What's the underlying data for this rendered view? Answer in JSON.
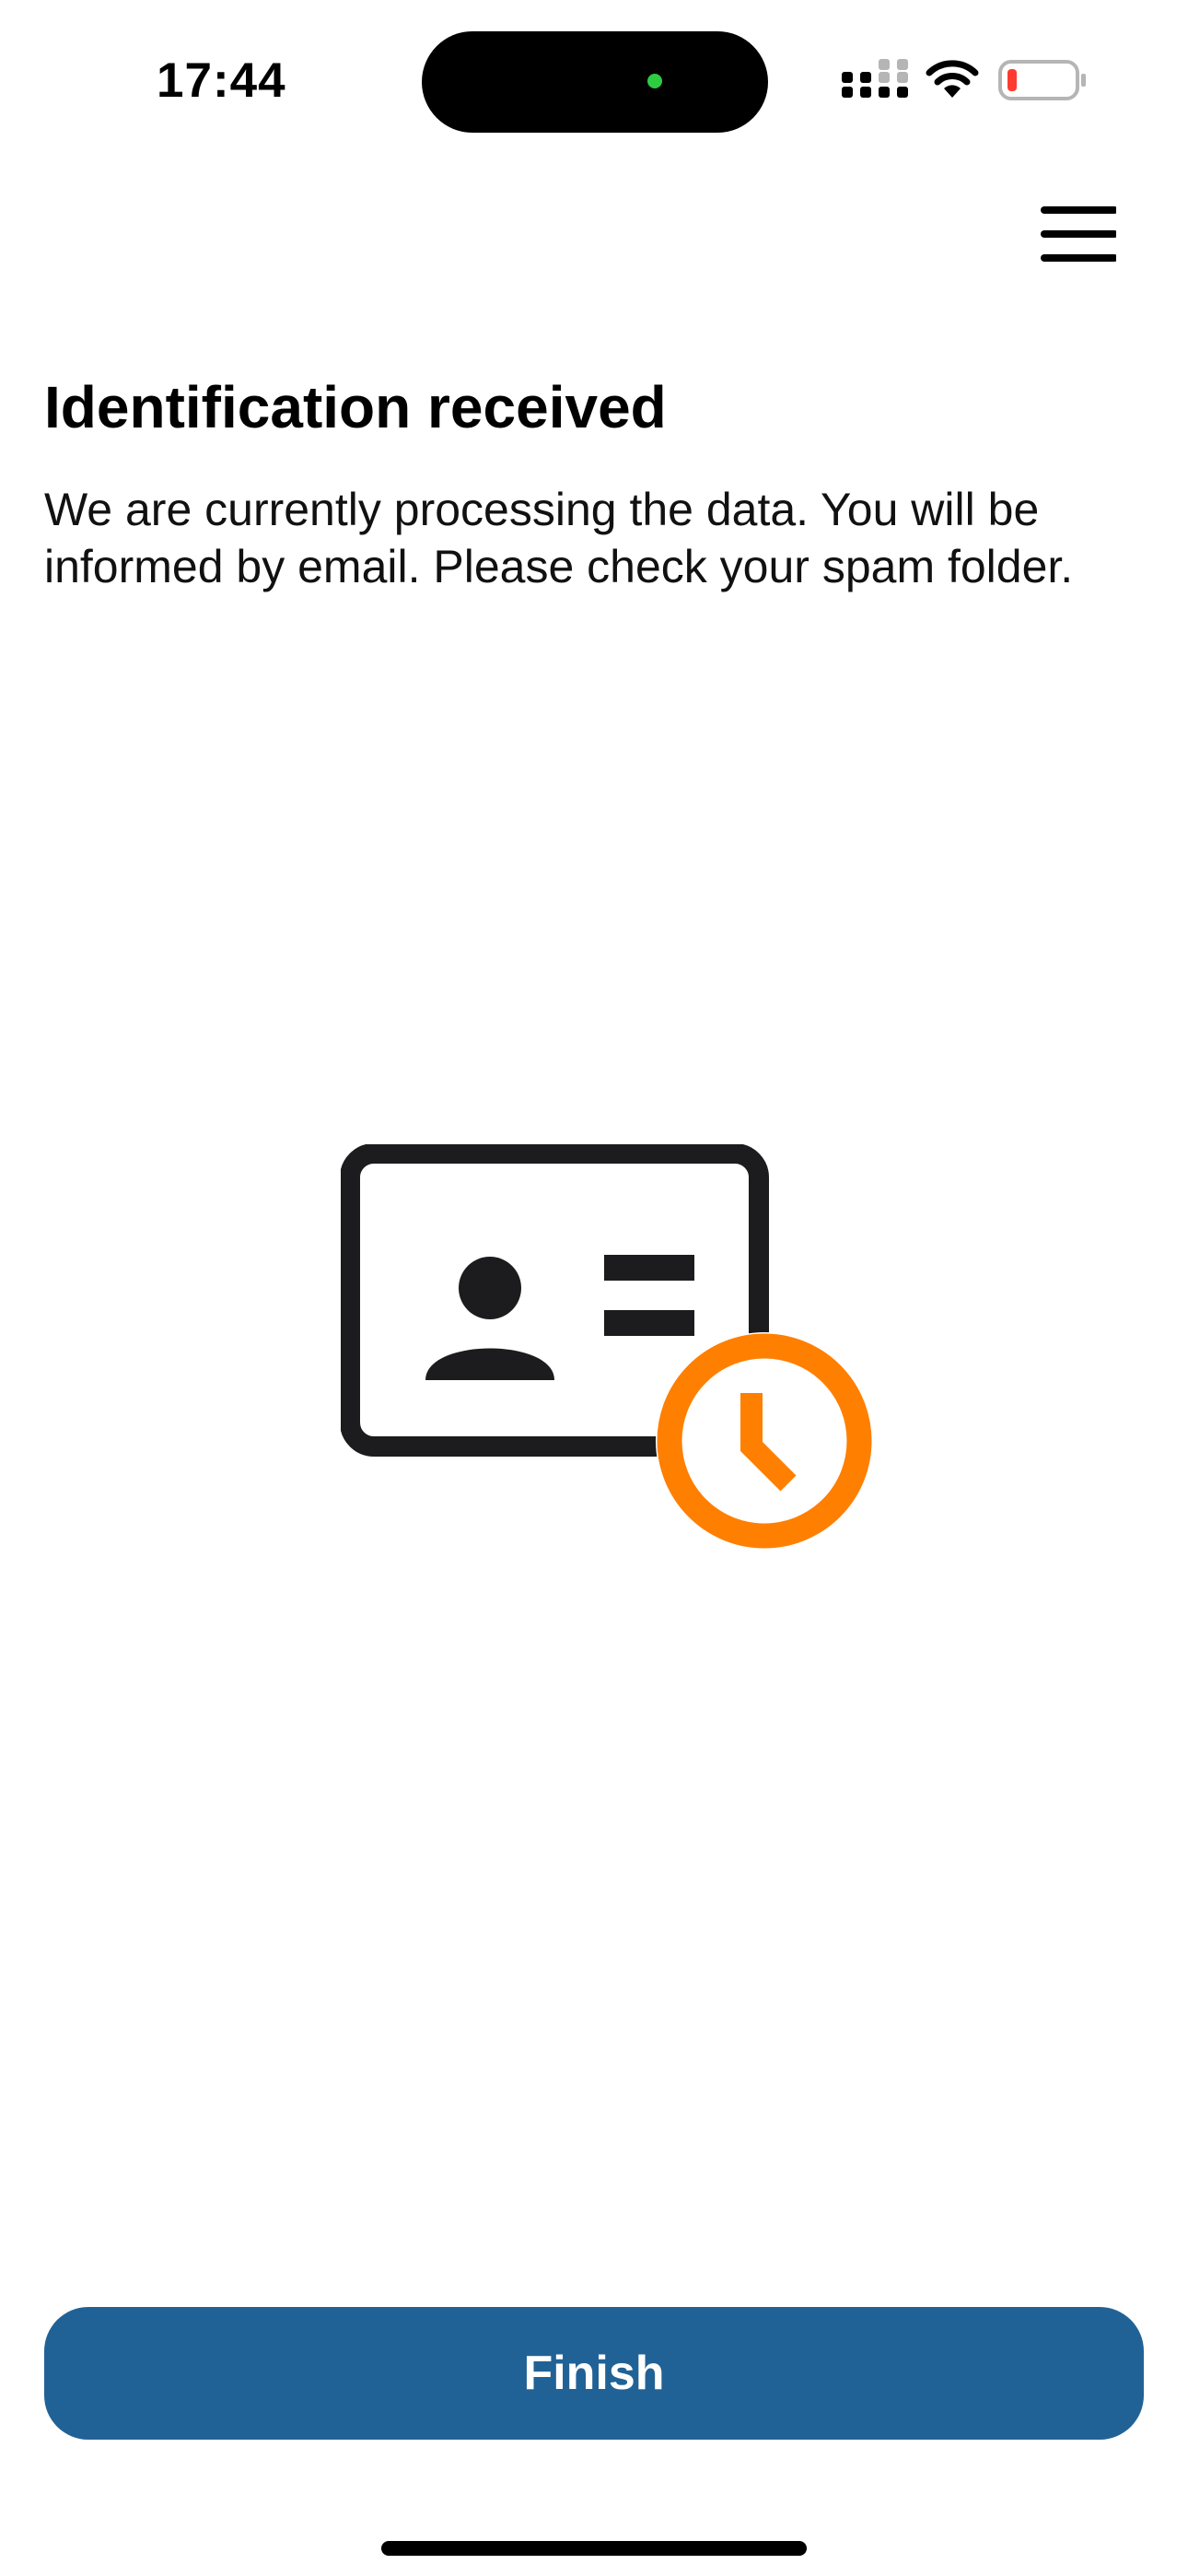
{
  "status_bar": {
    "time": "17:44",
    "battery_level": 0.1,
    "battery_color": "#ff3b30",
    "camera_indicator_color": "#2ecc40",
    "icons": [
      "cellular-signal-icon",
      "wifi-icon",
      "battery-low-icon"
    ]
  },
  "header": {
    "menu_icon": "hamburger-menu-icon"
  },
  "content": {
    "title": "Identification received",
    "message": "We are currently processing the data. You will be informed by email. Please check your spam folder."
  },
  "illustration": {
    "icon": "id-card-pending-icon",
    "card_color": "#1c1c1e",
    "clock_color": "#ff7f00"
  },
  "footer": {
    "finish_label": "Finish",
    "button_color": "#216296"
  }
}
